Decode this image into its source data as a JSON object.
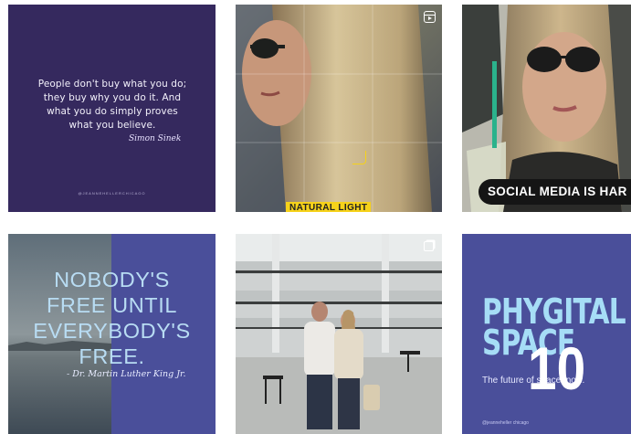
{
  "posts": {
    "quote": {
      "text": "People don't buy what you do; they buy why you do it. And what you do simply proves what you believe.",
      "signature": "Simon Sinek",
      "handle": "@JEANNEHELLERCHICAGO"
    },
    "natural_light": {
      "label": "NATURAL LIGHT",
      "type_icon": "reels-icon"
    },
    "social_media": {
      "label": "SOCIAL MEDIA IS HAR"
    },
    "nobody_free": {
      "line1": "NOBODY'S",
      "line2": "FREE UNTIL",
      "line3": "EVERYBODY'S",
      "line4": "FREE.",
      "signature": "- Dr. Martin Luther King Jr."
    },
    "group_photo": {
      "type_icon": "carousel-icon"
    },
    "phygital": {
      "title_line1": "PHYGITAL",
      "title_line2": "SPACE",
      "subtitle": "The future of space, now.",
      "handle": "@jeanneheller chicago",
      "overlay_number": "10"
    }
  },
  "colors": {
    "quote_bg": "#35295e",
    "accent_blue": "#4a4f9a",
    "light_blue_text": "#b8dcf3",
    "caption_yellow": "#f6d21a"
  }
}
